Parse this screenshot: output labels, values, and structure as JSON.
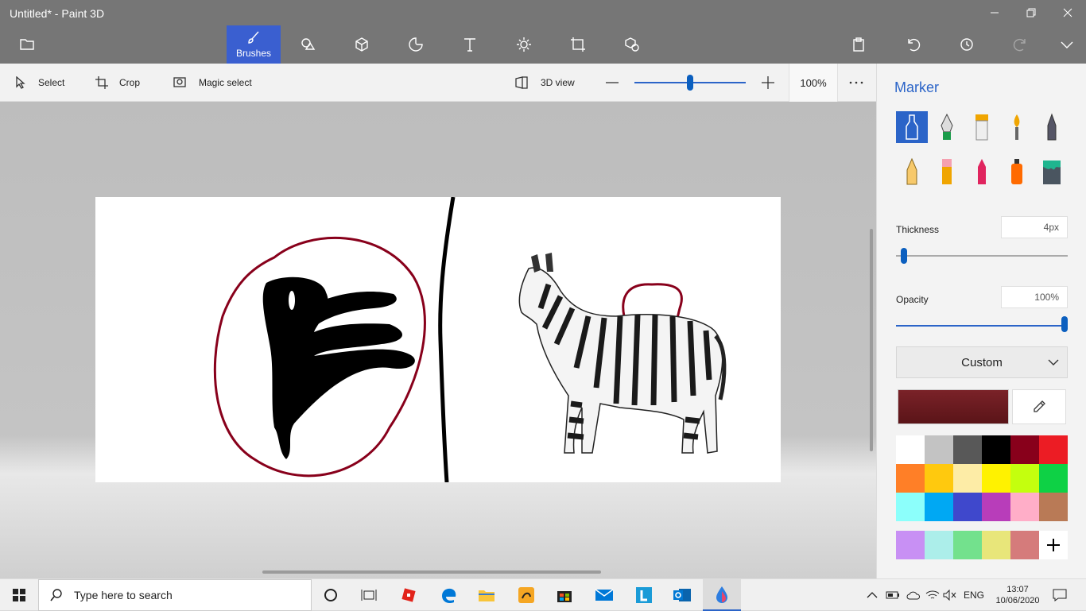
{
  "window": {
    "title": "Untitled* - Paint 3D"
  },
  "ribbon": {
    "brushes_label": "Brushes"
  },
  "toolbar": {
    "select": "Select",
    "crop": "Crop",
    "magic_select": "Magic select",
    "view_3d": "3D view",
    "zoom": "100%",
    "zoom_level": 0.5
  },
  "panel": {
    "title": "Marker",
    "thickness_label": "Thickness",
    "thickness_value": "4px",
    "opacity_label": "Opacity",
    "opacity_value": "100%",
    "color_mode": "Custom",
    "current_color": "#7a2228",
    "palette": [
      "#ffffff",
      "#c3c3c3",
      "#585858",
      "#000000",
      "#88001b",
      "#ec1c24",
      "#ff7f27",
      "#ffc90e",
      "#fdeca6",
      "#fff200",
      "#c4ff0e",
      "#0ed145",
      "#8cfffb",
      "#00a8f3",
      "#3f48cc",
      "#b83dba",
      "#ffaec8",
      "#b97a56"
    ],
    "custom_colors": [
      "#c890f4",
      "#aceeea",
      "#73e18d",
      "#e8e67a",
      "#d57b7b"
    ]
  },
  "taskbar": {
    "search_placeholder": "Type here to search",
    "language": "ENG",
    "time": "13:07",
    "date": "10/06/2020"
  }
}
